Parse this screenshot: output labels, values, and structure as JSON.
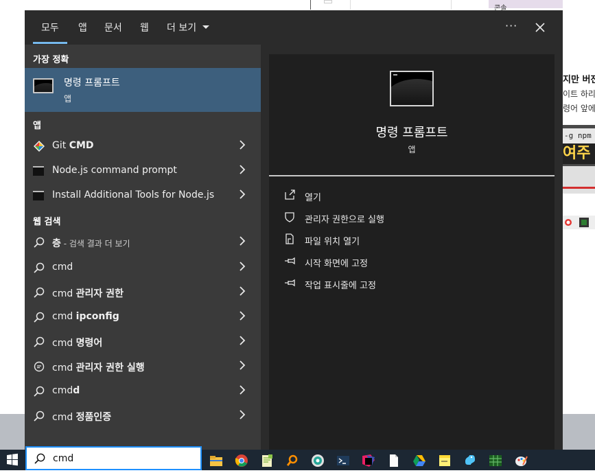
{
  "background": {
    "top_strip_text": "콘솔",
    "side_text_lines": [
      "지만 버전",
      "이트 하리",
      "령어 앞에"
    ],
    "terminal_snippet": "-g npm",
    "overlay_caption": "여주"
  },
  "tabs": [
    {
      "label": "모두",
      "selected": true
    },
    {
      "label": "앱"
    },
    {
      "label": "문서"
    },
    {
      "label": "웹"
    },
    {
      "label": "더 보기"
    }
  ],
  "more_options_label": "···",
  "close_label": "✕",
  "sections": {
    "best_match": "가장 정확",
    "apps": "앱",
    "web_search": "웹 검색"
  },
  "best_match": {
    "title": "명령 프롬프트",
    "subtitle": "앱"
  },
  "apps": [
    {
      "prefix": "Git ",
      "bold": "CMD",
      "icon": "git-icon"
    },
    {
      "prefix": "Node.js command prompt",
      "bold": "",
      "icon": "console-icon"
    },
    {
      "prefix": "Install Additional Tools for Node.js",
      "bold": "",
      "icon": "console-icon"
    }
  ],
  "web_results": [
    {
      "prefix": "층",
      "dim": " - 검색 결과 더 보기",
      "bold": "",
      "icon": "search-icon"
    },
    {
      "prefix": "cmd",
      "dim": "",
      "bold": "",
      "icon": "search-icon"
    },
    {
      "prefix": "cmd ",
      "dim": "",
      "bold": "관리자 권한",
      "icon": "search-icon"
    },
    {
      "prefix": "cmd ",
      "dim": "",
      "bold": "ipconfig",
      "icon": "search-icon"
    },
    {
      "prefix": "cmd ",
      "dim": "",
      "bold": "명령어",
      "icon": "search-icon"
    },
    {
      "prefix": "cmd ",
      "dim": "",
      "bold": "관리자 권한 실행",
      "icon": "chat-icon"
    },
    {
      "prefix": "cmd",
      "dim": "",
      "bold": "d",
      "icon": "search-icon"
    },
    {
      "prefix": "cmd ",
      "dim": "",
      "bold": "정품인증",
      "icon": "search-icon"
    }
  ],
  "preview": {
    "title": "명령 프롬프트",
    "subtitle": "앱",
    "actions": [
      {
        "label": "열기",
        "icon": "open-icon"
      },
      {
        "label": "관리자 권한으로 실행",
        "icon": "shield-icon"
      },
      {
        "label": "파일 위치 열기",
        "icon": "file-icon"
      },
      {
        "label": "시작 화면에 고정",
        "icon": "pin-icon"
      },
      {
        "label": "작업 표시줄에 고정",
        "icon": "pin-icon"
      }
    ]
  },
  "taskbar": {
    "search_value": "cmd",
    "apps": [
      "file-explorer-icon",
      "chrome-icon",
      "notepad-plus-icon",
      "search-tool-icon",
      "globe-tool-icon",
      "powershell-icon",
      "jetbrains-icon",
      "document-icon",
      "drive-icon",
      "sticky-notes-icon",
      "python-icon",
      "excel-sheet-icon",
      "paint-icon"
    ]
  },
  "colors": {
    "flyout_bg": "#2b2b2b",
    "left_pane_bg": "#3a3a3a",
    "selected_bg": "#3d5f7d",
    "accent": "#76b9ed",
    "taskbar_bg": "#1c2733"
  }
}
